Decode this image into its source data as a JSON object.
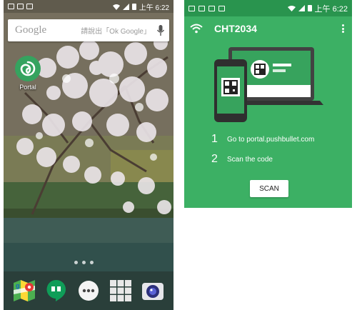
{
  "left_phone": {
    "status_time": "上午 6:22",
    "search": {
      "logo": "Google",
      "hint": "請說出「Ok Google」"
    },
    "apps": [
      {
        "label": "Portal",
        "icon": "portal-swirl-icon"
      }
    ],
    "dock": [
      {
        "icon": "google-maps-icon"
      },
      {
        "icon": "hangouts-icon"
      },
      {
        "icon": "app-drawer-icon"
      },
      {
        "icon": "apps-grid-icon"
      },
      {
        "icon": "camera-icon"
      }
    ],
    "colors": {
      "portal_green": "#35a35f"
    }
  },
  "right_phone": {
    "status_time": "上午 6:22",
    "toolbar": {
      "title": "CHT2034",
      "wifi_icon": "wifi-icon",
      "menu_icon": "overflow-menu-icon"
    },
    "steps": [
      {
        "num": "1",
        "text": "Go to portal.pushbullet.com"
      },
      {
        "num": "2",
        "text": "Scan the code"
      }
    ],
    "scan_button": "SCAN",
    "colors": {
      "status_bar": "#29944e",
      "panel": "#3cb064",
      "laptop_screen": "#37a35d"
    }
  }
}
